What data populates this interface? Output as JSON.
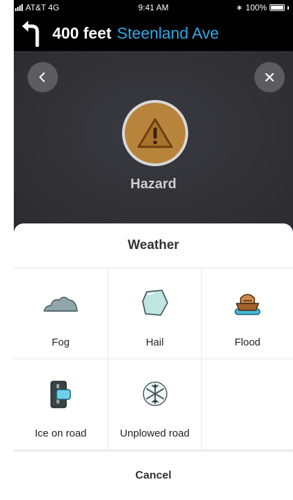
{
  "status_bar": {
    "carrier": "AT&T 4G",
    "time": "9:41 AM",
    "battery": "100%"
  },
  "navigation": {
    "distance": "400 feet",
    "street": "Steenland Ave",
    "turn_icon": "turn-left-arrow-icon"
  },
  "report": {
    "category": "Hazard",
    "back_icon": "chevron-left-icon",
    "close_icon": "close-icon",
    "category_icon": "warning-triangle-icon"
  },
  "sheet": {
    "title": "Weather",
    "options": [
      {
        "label": "Fog",
        "icon": "fog-cloud-icon"
      },
      {
        "label": "Hail",
        "icon": "hail-ice-icon"
      },
      {
        "label": "Flood",
        "icon": "flood-ark-icon"
      },
      {
        "label": "Ice on road",
        "icon": "ice-on-road-icon"
      },
      {
        "label": "Unplowed road",
        "icon": "snowflake-icon"
      }
    ],
    "cancel_label": "Cancel"
  },
  "colors": {
    "street": "#2fa9e6",
    "hazard": "#b8843c",
    "overlay": "#2c2c30"
  }
}
